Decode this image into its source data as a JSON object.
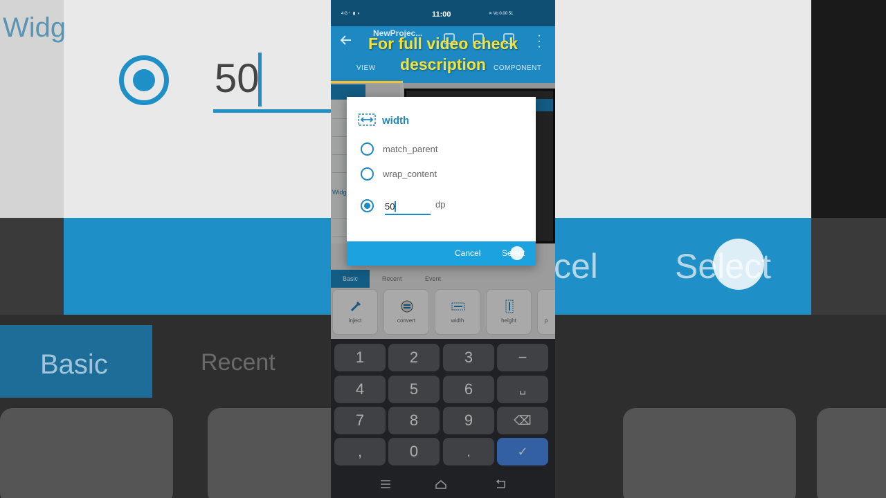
{
  "status_bar": {
    "time": "11:00",
    "left_indicators": "4G⁺ ▮ ◐",
    "right_indicators": "✕ Vo 0.00 51"
  },
  "app_bar": {
    "title": "NewProjec...",
    "tabs": [
      "VIEW",
      "COMPONENT"
    ]
  },
  "overlay": {
    "line1": "For full video check",
    "line2": "description"
  },
  "palette": {
    "section_label": "Widg"
  },
  "dialog": {
    "title": "width",
    "options": [
      {
        "label": "match_parent",
        "selected": false
      },
      {
        "label": "wrap_content",
        "selected": false
      }
    ],
    "custom_value": "50",
    "custom_unit": "dp",
    "custom_selected": true,
    "cancel_label": "Cancel",
    "select_label": "Select"
  },
  "panel": {
    "tabs": [
      "Basic",
      "Recent",
      "Event"
    ],
    "tiles": [
      "inject",
      "convert",
      "width",
      "height",
      "p"
    ]
  },
  "keyboard": {
    "rows": [
      [
        "1",
        "2",
        "3",
        "−"
      ],
      [
        "4",
        "5",
        "6",
        "␣"
      ],
      [
        "7",
        "8",
        "9",
        "⌫"
      ],
      [
        ",",
        "0",
        ".",
        "✓"
      ]
    ]
  },
  "background": {
    "widget_label": "Widg",
    "value": "50",
    "cancel_fragment": "cel",
    "select_fragment": "Select",
    "basic_tab": "Basic",
    "recent_tab": "Recent"
  }
}
